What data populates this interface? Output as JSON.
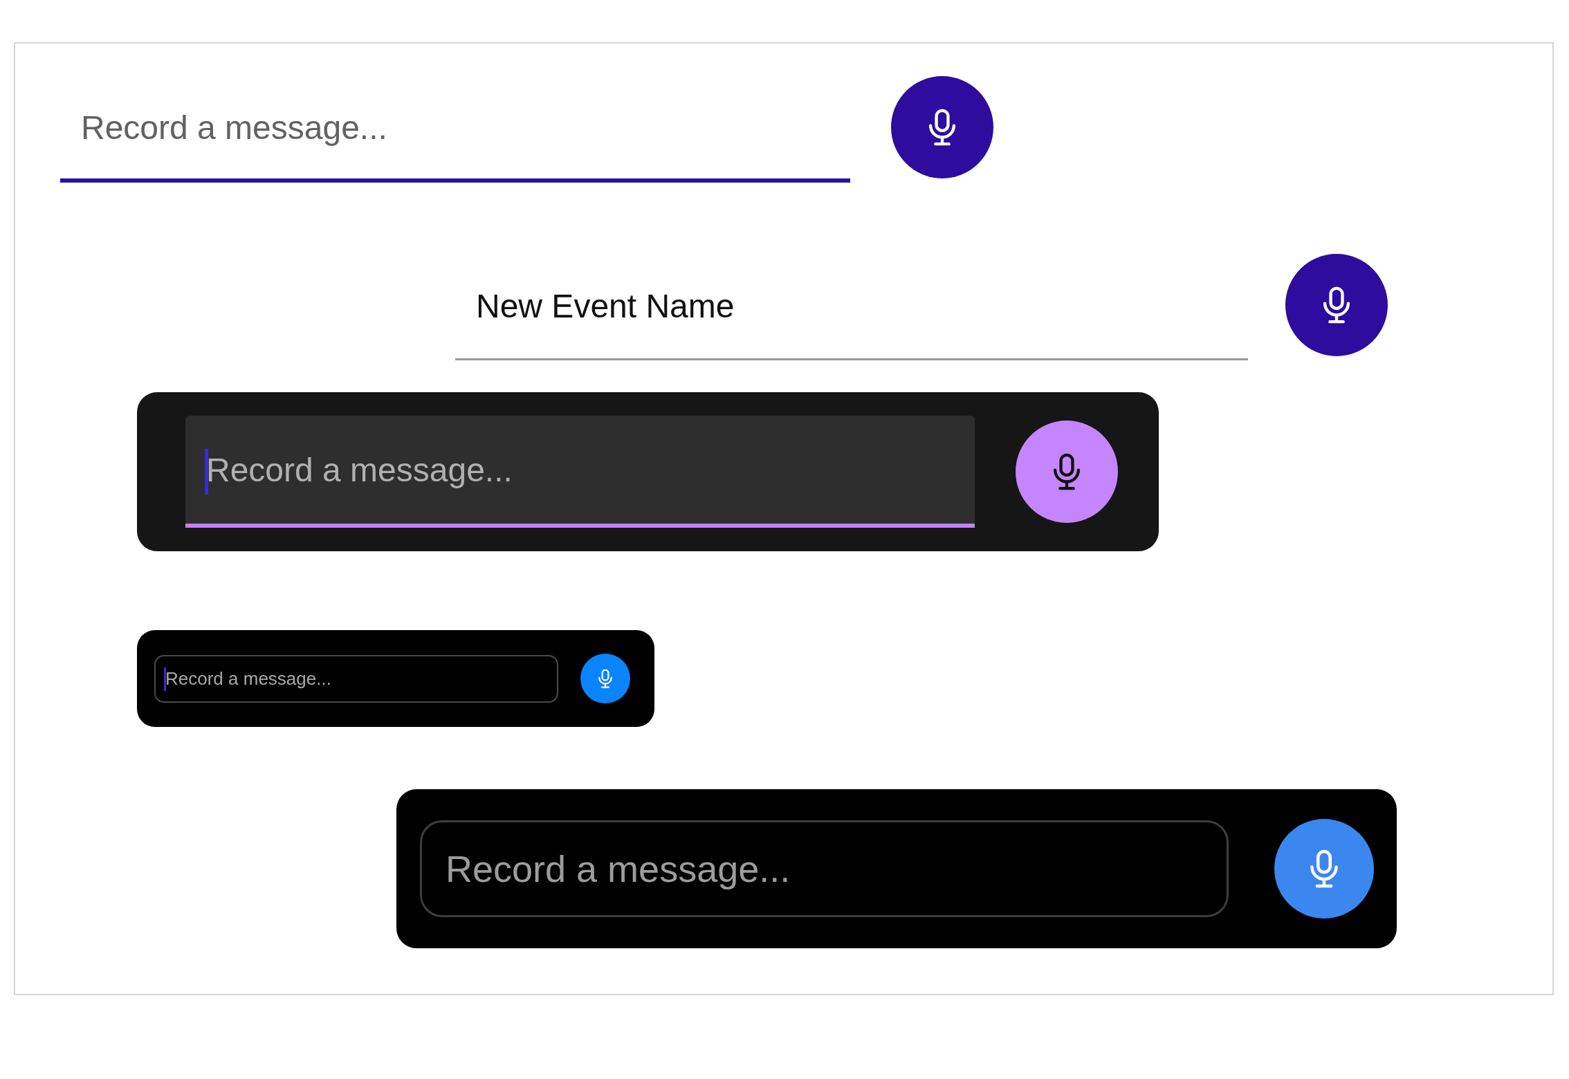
{
  "inputs": [
    {
      "kind": "underline",
      "placeholder": "Record a message...",
      "focused": true
    },
    {
      "kind": "underline",
      "value": "New Event Name",
      "focused": false
    },
    {
      "kind": "filled-dark",
      "placeholder": "Record a message...",
      "focused": true
    },
    {
      "kind": "compact-dark",
      "placeholder": "Record a message...",
      "focused": true
    },
    {
      "kind": "outlined-dark",
      "placeholder": "Record a message...",
      "focused": false
    }
  ]
}
